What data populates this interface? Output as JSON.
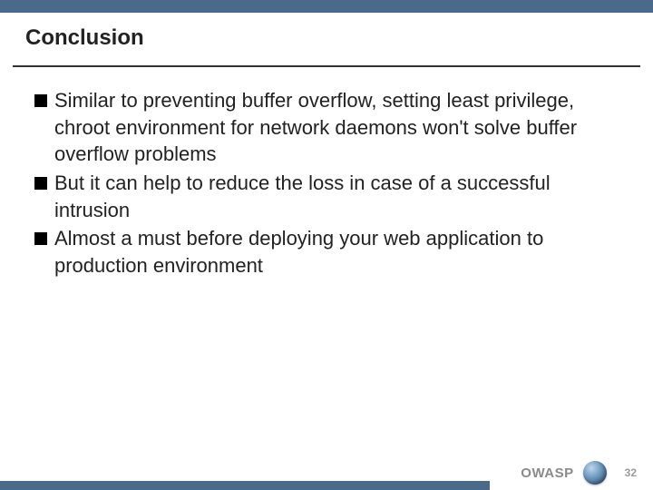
{
  "slide": {
    "title": "Conclusion",
    "bullets": [
      "Similar to preventing buffer overflow, setting least privilege, chroot environment for network daemons won't solve buffer overflow problems",
      "But it can help to reduce the loss in case of a successful intrusion",
      "Almost a must before deploying your web application to production environment"
    ]
  },
  "footer": {
    "org": "OWASP",
    "page": "32"
  }
}
